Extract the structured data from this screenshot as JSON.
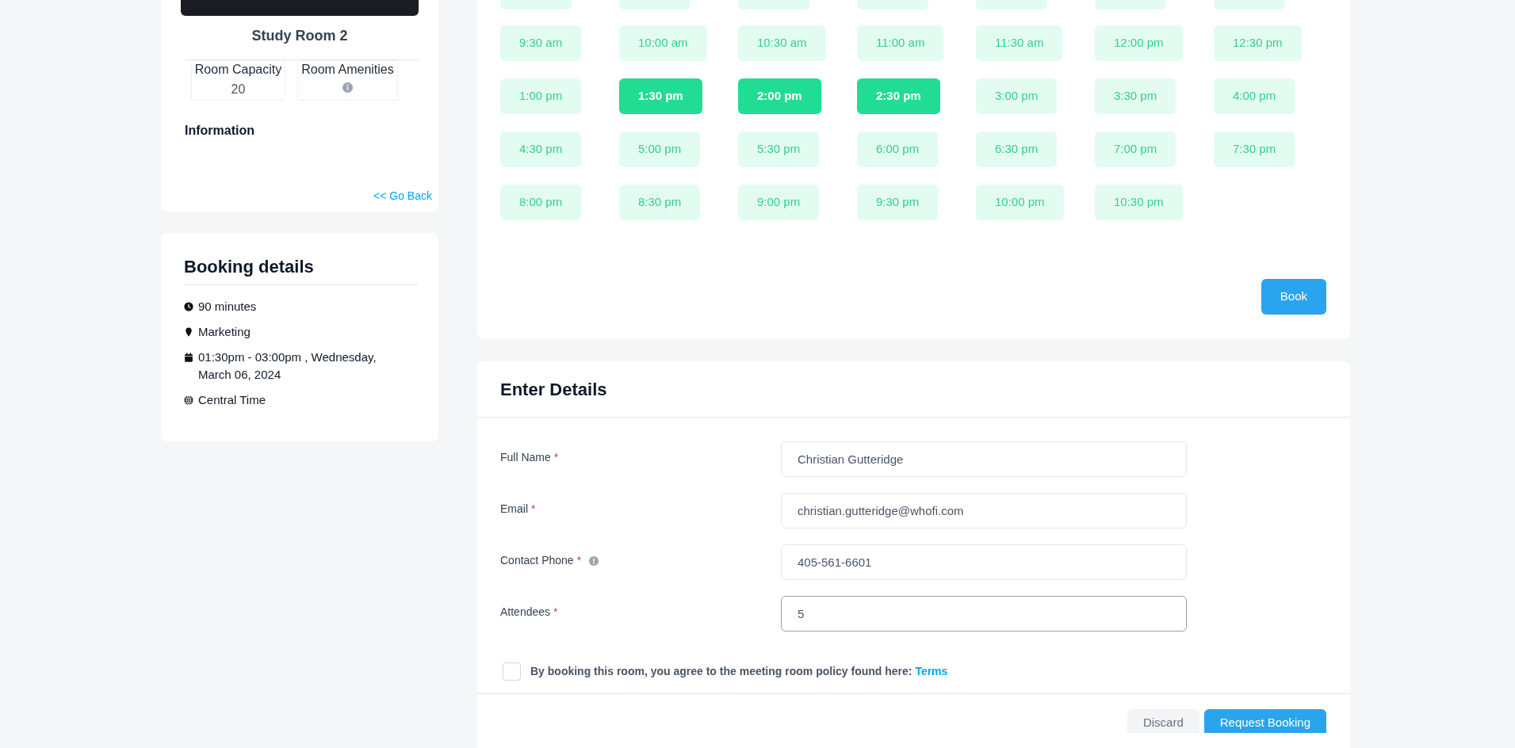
{
  "room": {
    "name": "Study Room 2",
    "capacity_label": "Room Capacity",
    "capacity": "20",
    "amenities_label": "Room Amenities",
    "information_heading": "Information",
    "back_link": "<< Go Back"
  },
  "booking_details": {
    "title": "Booking details",
    "items": [
      {
        "kind": "duration",
        "text": "90 minutes"
      },
      {
        "kind": "location",
        "text": "Marketing"
      },
      {
        "kind": "date",
        "text": "01:30pm - 03:00pm , Wednesday, March 06, 2024"
      },
      {
        "kind": "timezone",
        "text": "Central Time"
      }
    ]
  },
  "time_slots": [
    {
      "label": "9:30 am",
      "selected": false
    },
    {
      "label": "10:00 am",
      "selected": false
    },
    {
      "label": "10:30 am",
      "selected": false
    },
    {
      "label": "11:00 am",
      "selected": false
    },
    {
      "label": "11:30 am",
      "selected": false
    },
    {
      "label": "12:00 pm",
      "selected": false
    },
    {
      "label": "12:30 pm",
      "selected": false
    },
    {
      "label": "1:00 pm",
      "selected": false
    },
    {
      "label": "1:30 pm",
      "selected": true
    },
    {
      "label": "2:00 pm",
      "selected": true
    },
    {
      "label": "2:30 pm",
      "selected": true
    },
    {
      "label": "3:00 pm",
      "selected": false
    },
    {
      "label": "3:30 pm",
      "selected": false
    },
    {
      "label": "4:00 pm",
      "selected": false
    },
    {
      "label": "4:30 pm",
      "selected": false
    },
    {
      "label": "5:00 pm",
      "selected": false
    },
    {
      "label": "5:30 pm",
      "selected": false
    },
    {
      "label": "6:00 pm",
      "selected": false
    },
    {
      "label": "6:30 pm",
      "selected": false
    },
    {
      "label": "7:00 pm",
      "selected": false
    },
    {
      "label": "7:30 pm",
      "selected": false
    },
    {
      "label": "8:00 pm",
      "selected": false
    },
    {
      "label": "8:30 pm",
      "selected": false
    },
    {
      "label": "9:00 pm",
      "selected": false
    },
    {
      "label": "9:30 pm",
      "selected": false
    },
    {
      "label": "10:00 pm",
      "selected": false
    },
    {
      "label": "10:30 pm",
      "selected": false
    }
  ],
  "book_button": "Book",
  "details_form": {
    "title": "Enter Details",
    "fields": [
      {
        "label": "Full Name",
        "required_mark": "*",
        "info_icon": false,
        "value": "Christian Gutteridge",
        "focused": false
      },
      {
        "label": "Email",
        "required_mark": "*",
        "info_icon": false,
        "value": "christian.gutteridge@whofi.com",
        "focused": false
      },
      {
        "label": "Contact Phone",
        "required_mark": "*",
        "info_icon": true,
        "value": "405-561-6601",
        "focused": false
      },
      {
        "label": "Attendees",
        "required_mark": "*",
        "info_icon": false,
        "value": "5",
        "focused": true
      }
    ],
    "agreement": {
      "checked": false,
      "text": "By booking this room, you agree to the meeting room policy found here:",
      "link": "Terms"
    },
    "buttons": [
      {
        "label": "Discard",
        "kind": "secondary"
      },
      {
        "label": "Request Booking",
        "kind": "primary"
      }
    ]
  }
}
